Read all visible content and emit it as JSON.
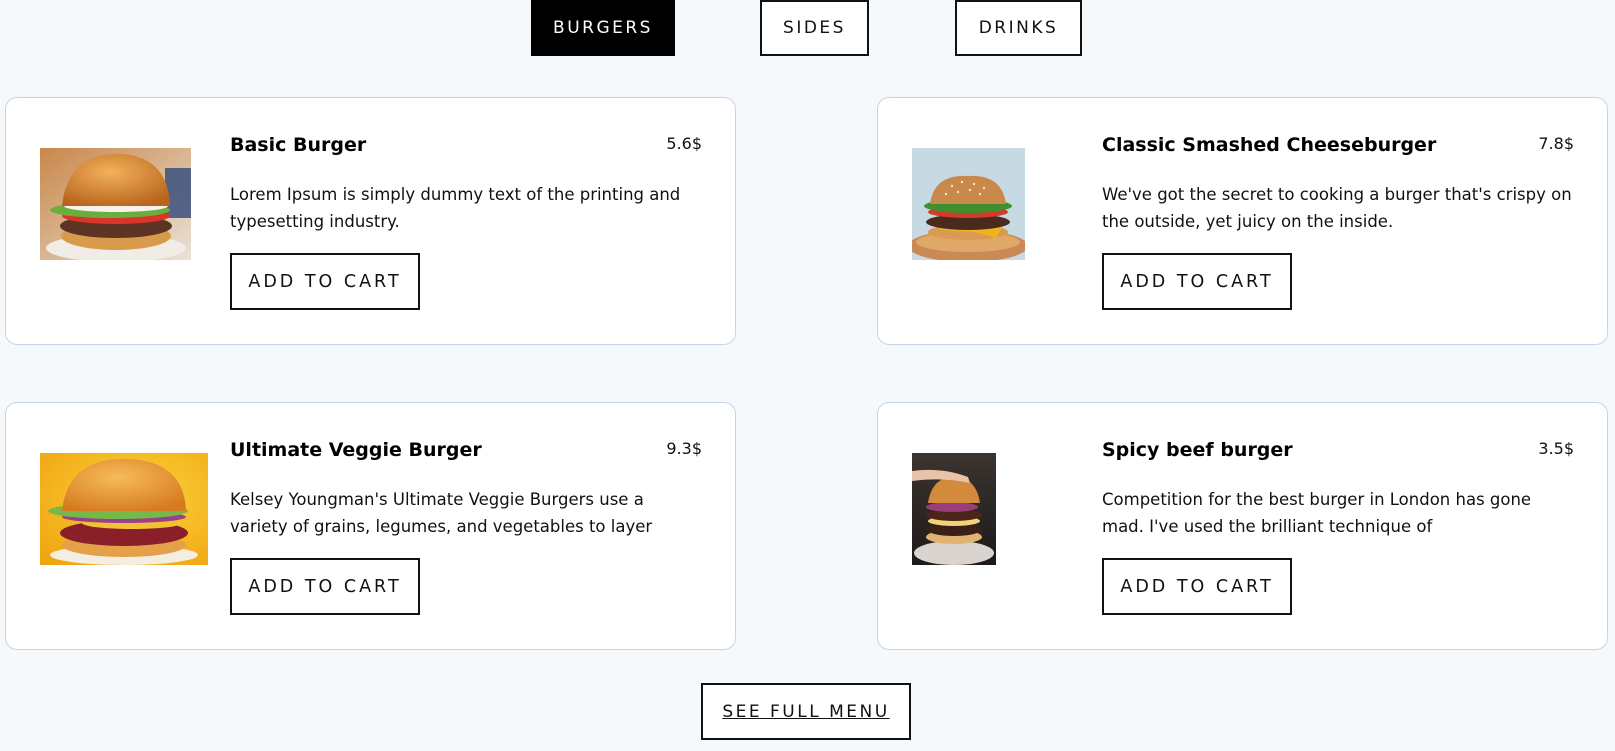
{
  "tabs": [
    {
      "label": "BURGERS",
      "active": true
    },
    {
      "label": "SIDES",
      "active": false
    },
    {
      "label": "DRINKS",
      "active": false
    }
  ],
  "products": [
    {
      "title": "Basic Burger",
      "price": "5.6$",
      "description": "Lorem Ipsum is simply dummy text of the printing and typesetting industry.",
      "button_label": "ADD TO CART",
      "image": "basic-burger-photo"
    },
    {
      "title": "Classic Smashed Cheeseburger",
      "price": "7.8$",
      "description": "We've got the secret to cooking a burger that's crispy on the outside, yet juicy on the inside.",
      "button_label": "ADD TO CART",
      "image": "smashed-cheeseburger-photo"
    },
    {
      "title": "Ultimate Veggie Burger",
      "price": "9.3$",
      "description": "Kelsey Youngman's Ultimate Veggie Burgers use a variety of grains, legumes, and vegetables to layer",
      "button_label": "ADD TO CART",
      "image": "veggie-burger-photo"
    },
    {
      "title": "Spicy beef burger",
      "price": "3.5$",
      "description": "Competition for the best burger in London has gone mad. I've used the brilliant technique of",
      "button_label": "ADD TO CART",
      "image": "spicy-beef-burger-photo"
    }
  ],
  "footer": {
    "see_full_menu_label": "SEE FULL MENU"
  },
  "colors": {
    "page_background": "#f5f9fc",
    "card_border": "#c9d3e6",
    "active_tab_background": "#000000",
    "active_tab_text": "#ffffff"
  }
}
